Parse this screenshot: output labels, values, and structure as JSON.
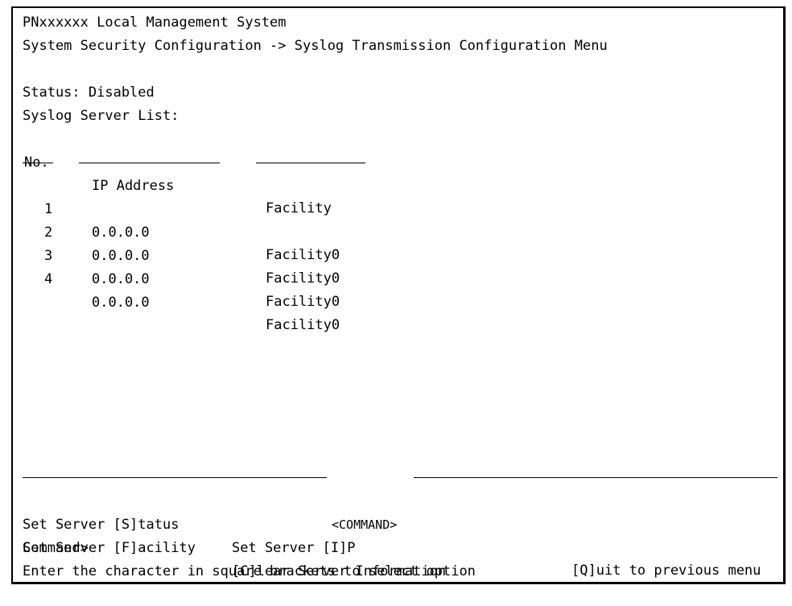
{
  "header": {
    "system_title": "PNxxxxxx Local Management System",
    "menu_path": "System Security Configuration -> Syslog Transmission Configuration Menu"
  },
  "status": {
    "label": "Status: Disabled"
  },
  "server_list": {
    "title": "Syslog Server List:",
    "columns": {
      "no": "No.",
      "ip": "IP Address",
      "facility": "Facility"
    },
    "rows": [
      {
        "no": "1",
        "ip": "0.0.0.0",
        "facility": "Facility0"
      },
      {
        "no": "2",
        "ip": "0.0.0.0",
        "facility": "Facility0"
      },
      {
        "no": "3",
        "ip": "0.0.0.0",
        "facility": "Facility0"
      },
      {
        "no": "4",
        "ip": "0.0.0.0",
        "facility": "Facility0"
      }
    ]
  },
  "command": {
    "section_label": "<COMMAND>",
    "options": {
      "set_status": "Set Server [S]tatus",
      "set_ip": "Set Server [I]P",
      "quit": "[Q]uit to previous menu",
      "set_facility": "Set Server [F]acility",
      "clear": "[C]lear Server Information"
    },
    "prompt": "Command>",
    "hint": "Enter the character in square brackets to select option"
  }
}
